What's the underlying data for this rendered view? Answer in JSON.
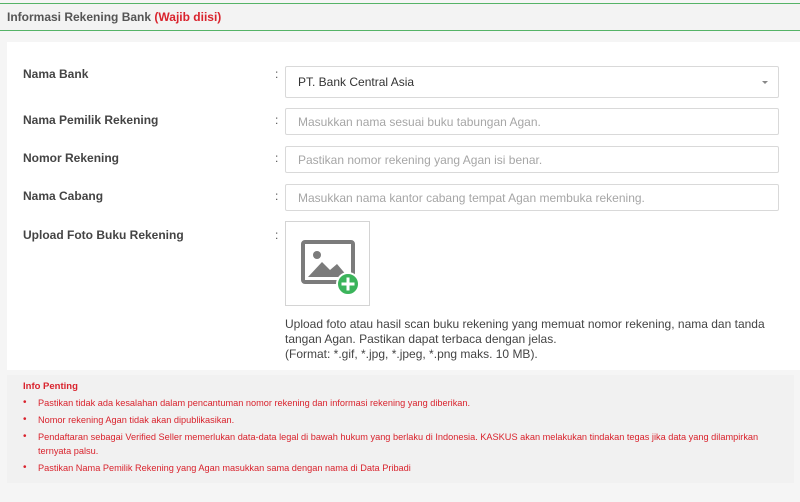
{
  "section": {
    "title": "Informasi Rekening Bank",
    "required_note": "(Wajib diisi)"
  },
  "form": {
    "bank": {
      "label": "Nama Bank",
      "colon": ":",
      "value": "PT. Bank Central Asia"
    },
    "owner": {
      "label": "Nama Pemilik Rekening",
      "colon": ":",
      "placeholder": "Masukkan nama sesuai buku tabungan Agan."
    },
    "account_number": {
      "label": "Nomor Rekening",
      "colon": ":",
      "placeholder": "Pastikan nomor rekening yang Agan isi benar."
    },
    "branch": {
      "label": "Nama Cabang",
      "colon": ":",
      "placeholder": "Masukkan nama kantor cabang tempat Agan membuka rekening."
    },
    "upload": {
      "label": "Upload Foto Buku Rekening",
      "colon": ":",
      "icon": "image-add-icon",
      "help_line1": "Upload foto atau hasil scan buku rekening yang memuat nomor rekening, nama dan tanda",
      "help_line2": "tangan Agan. Pastikan dapat terbaca dengan jelas.",
      "help_line3": "(Format: *.gif, *.jpg, *.jpeg, *.png maks. 10 MB)."
    }
  },
  "info": {
    "title": "Info Penting",
    "items": [
      "Pastikan tidak ada kesalahan dalam pencantuman nomor rekening dan informasi rekening yang diberikan.",
      "Nomor rekening Agan tidak akan dipublikasikan.",
      "Pendaftaran sebagai Verified Seller memerlukan data-data legal di bawah hukum yang berlaku di Indonesia. KASKUS akan melakukan tindakan tegas jika data yang dilampirkan ternyata palsu.",
      "Pastikan Nama Pemilik Rekening yang Agan masukkan sama dengan nama di Data Pribadi"
    ]
  },
  "colors": {
    "accent_green": "#55b367",
    "required_red": "#d9232d",
    "plus_badge_green": "#3bb45b"
  }
}
